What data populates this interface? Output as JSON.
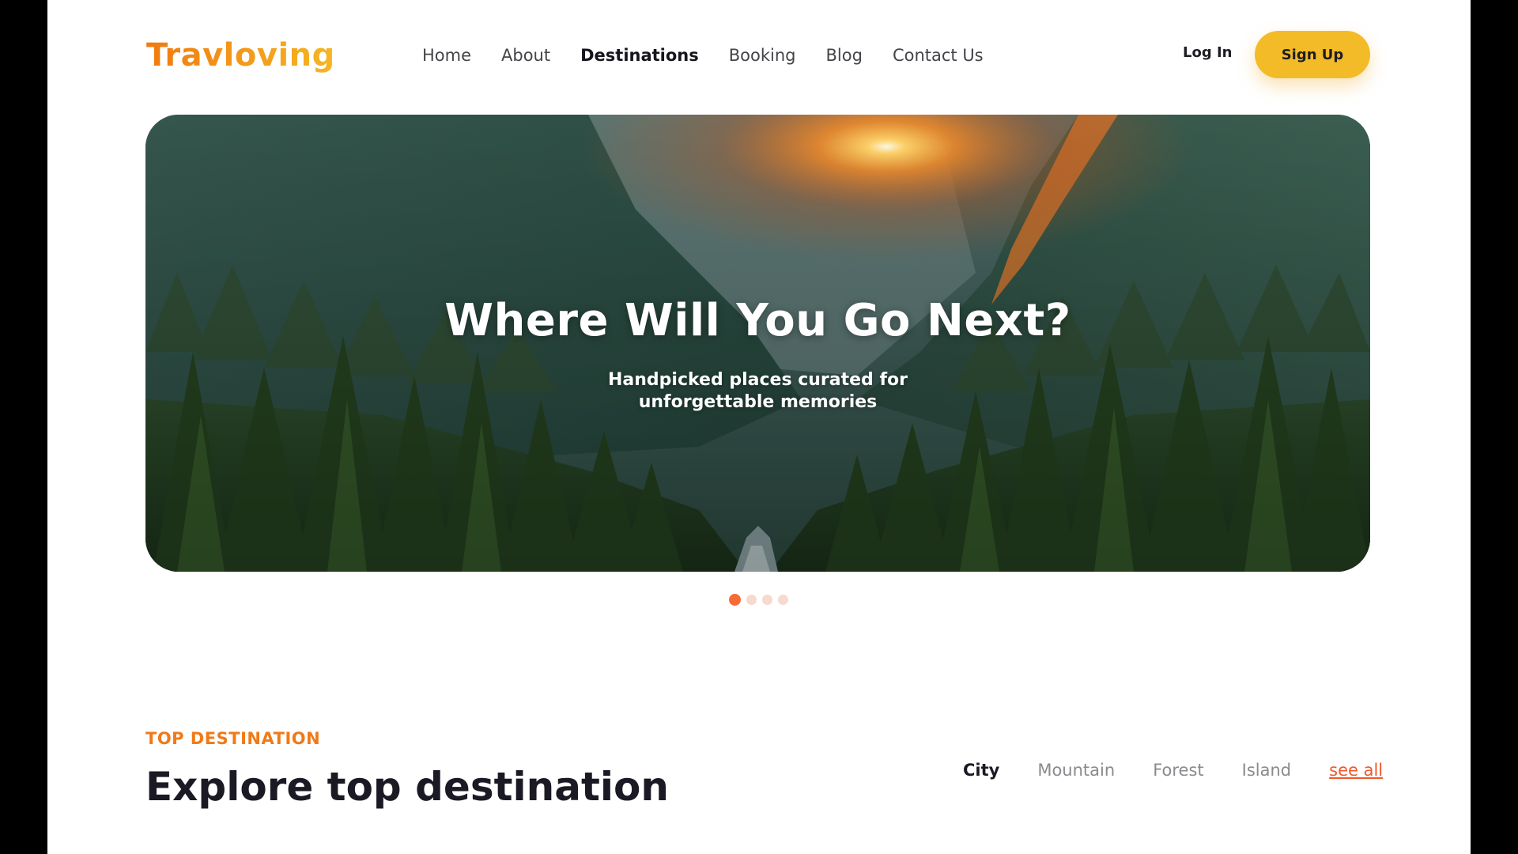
{
  "brand": {
    "logo": "Travloving"
  },
  "nav": {
    "items": [
      {
        "label": "Home"
      },
      {
        "label": "About"
      },
      {
        "label": "Destinations",
        "active": true
      },
      {
        "label": "Booking"
      },
      {
        "label": "Blog"
      },
      {
        "label": "Contact Us"
      }
    ]
  },
  "auth": {
    "login_label": "Log In",
    "signup_label": "Sign Up"
  },
  "hero": {
    "title": "Where Will You Go Next?",
    "subtitle": "Handpicked places curated for unforgettable memories",
    "slides_total": 4,
    "active_slide": 1
  },
  "section": {
    "eyebrow": "TOP DESTINATION",
    "title": "Explore top destination",
    "filters": [
      "City",
      "Mountain",
      "Forest",
      "Island"
    ],
    "active_filter": "City",
    "see_all_label": "see all"
  },
  "colors": {
    "accent_orange": "#f07a18",
    "signup_yellow": "#f2bb27",
    "dot_active": "#f56a35",
    "dot_inactive": "#f8d9cf",
    "link_red": "#f0582b"
  }
}
